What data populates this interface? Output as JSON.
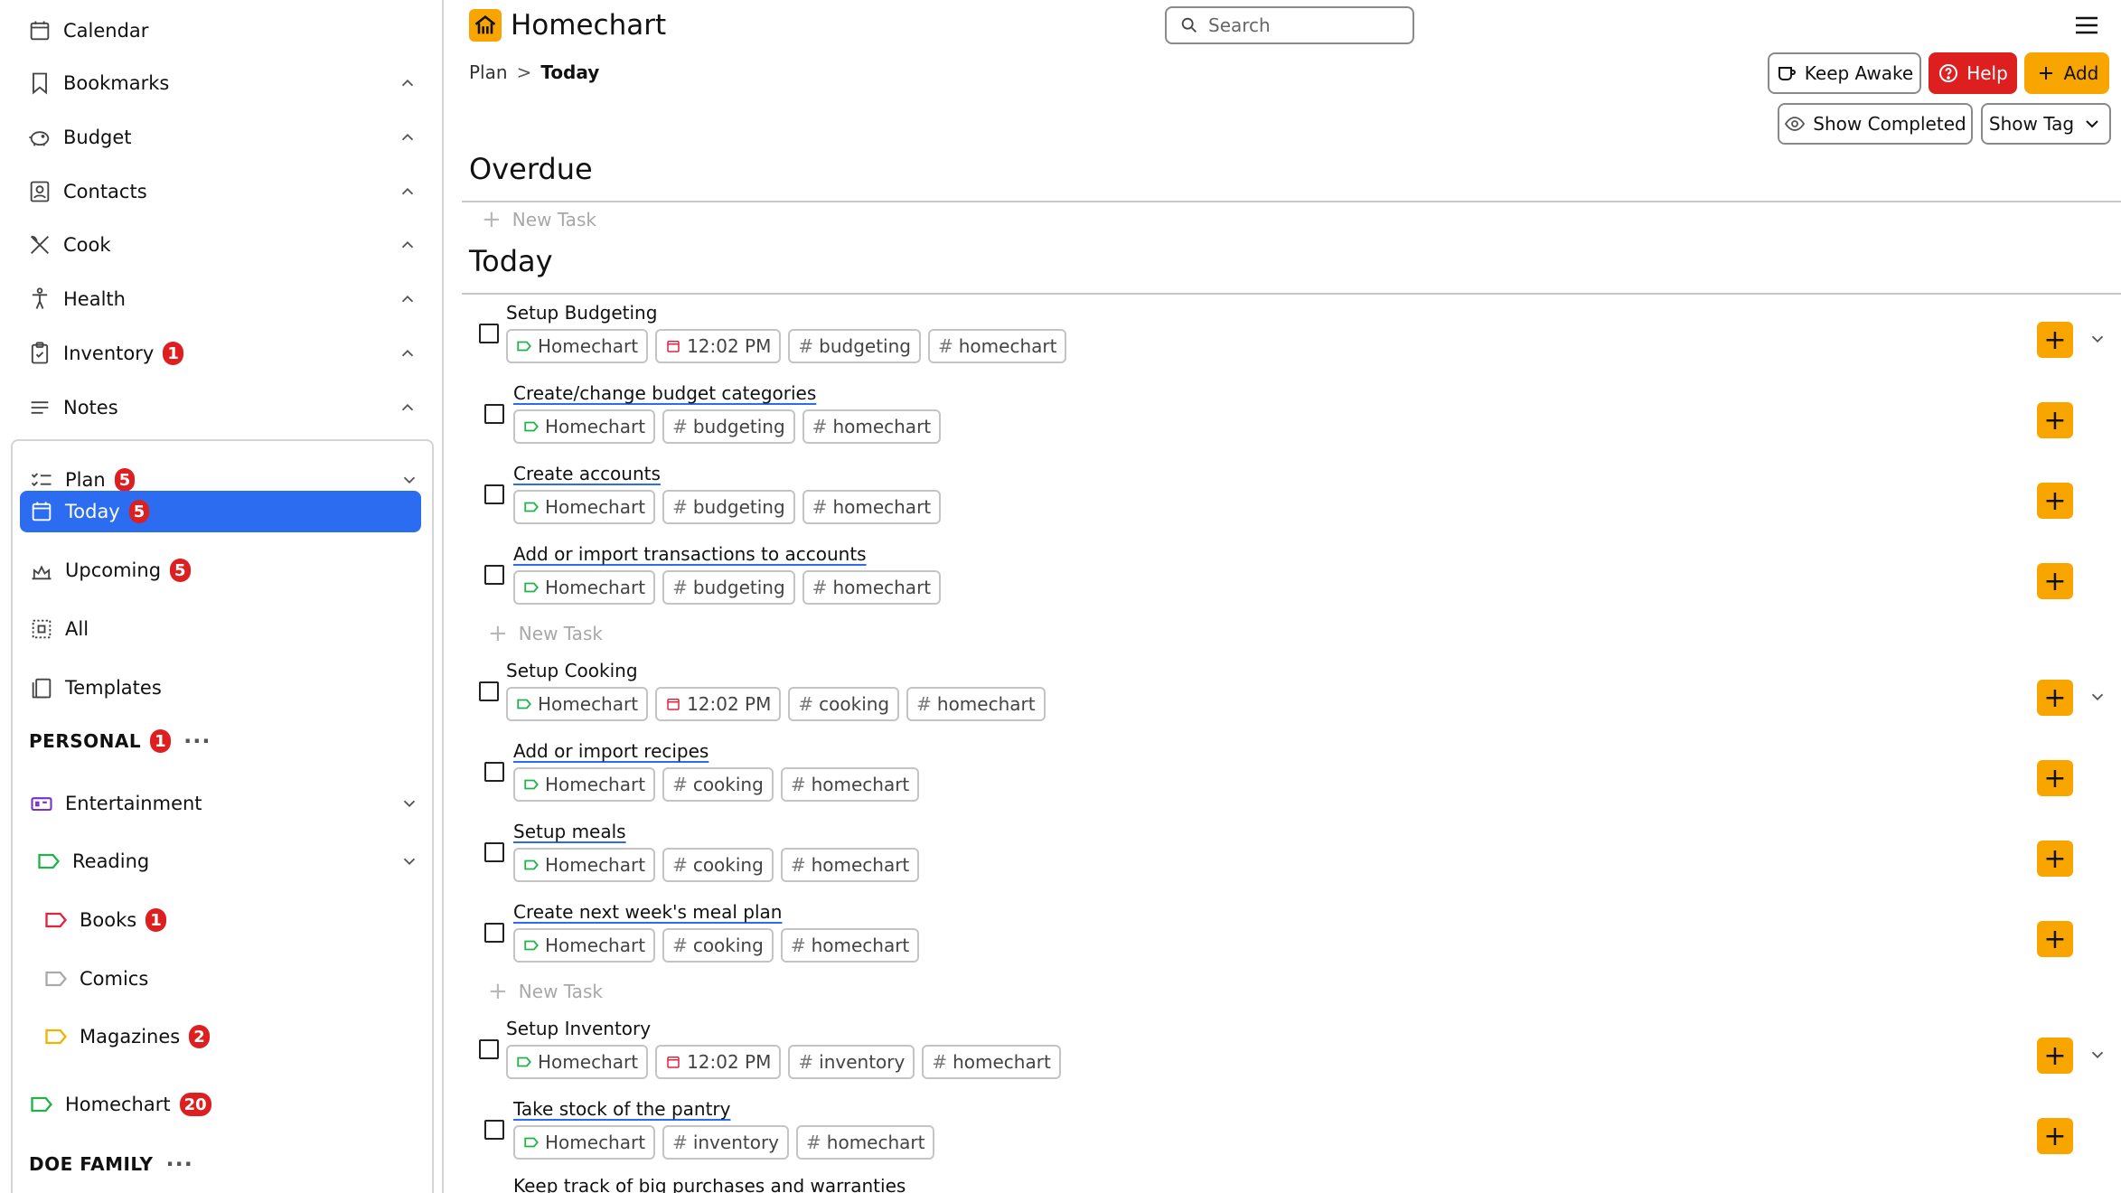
{
  "app": {
    "name": "Homechart"
  },
  "search": {
    "placeholder": "Search"
  },
  "sidebar": {
    "items": [
      {
        "label": "Calendar",
        "icon": "calendar-icon"
      },
      {
        "label": "Bookmarks",
        "icon": "bookmark-icon"
      },
      {
        "label": "Budget",
        "icon": "piggy-bank-icon"
      },
      {
        "label": "Contacts",
        "icon": "contacts-icon"
      },
      {
        "label": "Cook",
        "icon": "utensils-icon"
      },
      {
        "label": "Health",
        "icon": "person-icon"
      },
      {
        "label": "Inventory",
        "icon": "clipboard-icon",
        "badge": "1"
      },
      {
        "label": "Notes",
        "icon": "notes-icon"
      }
    ],
    "plan": {
      "label": "Plan",
      "badge": "5",
      "today": {
        "label": "Today",
        "badge": "5"
      },
      "upcoming": {
        "label": "Upcoming",
        "badge": "5"
      },
      "all": {
        "label": "All"
      },
      "templates": {
        "label": "Templates"
      },
      "personal": {
        "label": "PERSONAL",
        "badge": "1",
        "dots": "···"
      },
      "entertainment": {
        "label": "Entertainment"
      },
      "reading": {
        "label": "Reading"
      },
      "books": {
        "label": "Books",
        "badge": "1"
      },
      "comics": {
        "label": "Comics"
      },
      "magazines": {
        "label": "Magazines",
        "badge": "2"
      },
      "homechart": {
        "label": "Homechart",
        "badge": "20"
      },
      "doe_family": {
        "label": "DOE FAMILY",
        "dots": "···"
      }
    }
  },
  "breadcrumb": {
    "root": "Plan",
    "sep": ">",
    "current": "Today"
  },
  "toolbar": {
    "keep_awake": "Keep Awake",
    "help": "Help",
    "add": "Add",
    "show_completed": "Show Completed",
    "show_tag": "Show Tag"
  },
  "colors": {
    "accent": "#f8a500",
    "primary": "#2c6cf0",
    "danger": "#dd1f1f",
    "tag_green": "#22b24c",
    "tag_red": "#e0233f",
    "tag_yellow": "#f0b400",
    "tag_purple": "#7a2fc7"
  },
  "main": {
    "overdue_title": "Overdue",
    "today_title": "Today",
    "new_task": "New Task",
    "tasks": [
      {
        "name": "Setup Budgeting",
        "project": "Homechart",
        "time": "12:02 PM",
        "tags": [
          "budgeting",
          "homechart"
        ]
      },
      {
        "name": "Create/change budget categories",
        "project": "Homechart",
        "tags": [
          "budgeting",
          "homechart"
        ]
      },
      {
        "name": "Create accounts",
        "project": "Homechart",
        "tags": [
          "budgeting",
          "homechart"
        ]
      },
      {
        "name": "Add or import transactions to accounts",
        "project": "Homechart",
        "tags": [
          "budgeting",
          "homechart"
        ]
      },
      {
        "name": "Setup Cooking",
        "project": "Homechart",
        "time": "12:02 PM",
        "tags": [
          "cooking",
          "homechart"
        ]
      },
      {
        "name": "Add or import recipes",
        "project": "Homechart",
        "tags": [
          "cooking",
          "homechart"
        ]
      },
      {
        "name": "Setup meals",
        "project": "Homechart",
        "tags": [
          "cooking",
          "homechart"
        ]
      },
      {
        "name": "Create next week's meal plan",
        "project": "Homechart",
        "tags": [
          "cooking",
          "homechart"
        ]
      },
      {
        "name": "Setup Inventory",
        "project": "Homechart",
        "time": "12:02 PM",
        "tags": [
          "inventory",
          "homechart"
        ]
      },
      {
        "name": "Take stock of the pantry",
        "project": "Homechart",
        "tags": [
          "inventory",
          "homechart"
        ]
      },
      {
        "name": "Keep track of big purchases and warranties"
      }
    ]
  }
}
